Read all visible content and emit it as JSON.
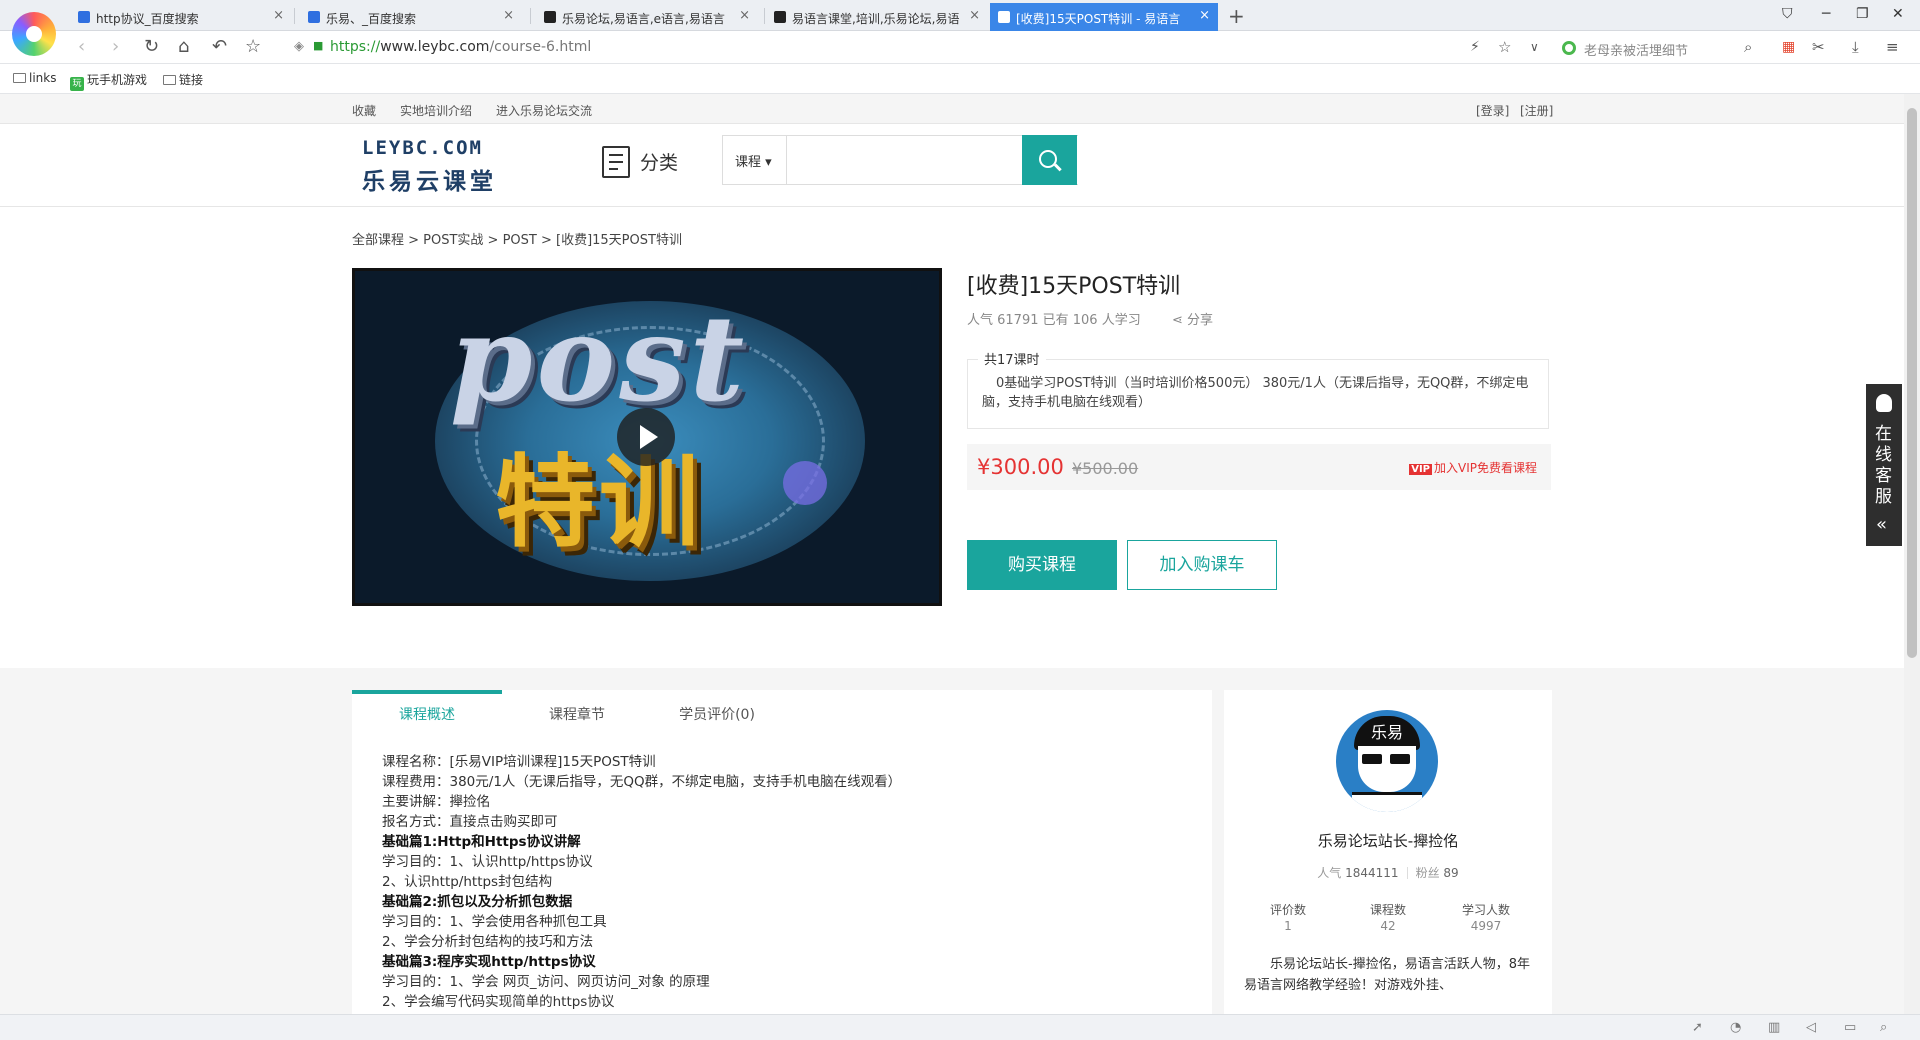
{
  "browser": {
    "tabs": [
      {
        "title": "http协议_百度搜索",
        "icon": "baidu-paw-icon",
        "active": false
      },
      {
        "title": "乐易、_百度搜索",
        "icon": "baidu-paw-icon",
        "active": false
      },
      {
        "title": "乐易论坛,易语言,e语言,易语言",
        "icon": "site-icon",
        "active": false
      },
      {
        "title": "易语言课堂,培训,乐易论坛,易语",
        "icon": "site-icon",
        "active": false
      },
      {
        "title": "[收费]15天POST特训 - 易语言",
        "icon": "site-icon",
        "active": true
      }
    ],
    "new_tab": "+",
    "url_scheme": "https://",
    "url_host": "www.leybc.com",
    "url_path": "/course-6.html",
    "search_hint": "老母亲被活埋细节",
    "bookmarks": [
      "links",
      "玩手机游戏",
      "链接"
    ],
    "accent": "#3a86e8"
  },
  "site": {
    "topbar": {
      "favorite": "收藏",
      "training": "实地培训介绍",
      "forum": "进入乐易论坛交流",
      "login": "[登录]",
      "register": "[注册]"
    },
    "logo_en": "LEYBC.COM",
    "logo_cn": "乐易云课堂",
    "category_label": "分类",
    "search_select": "课程",
    "search_placeholder": "",
    "accent": "#1aa59d"
  },
  "breadcrumb": "全部课程 > POST实战 > POST > [收费]15天POST特训",
  "video": {
    "title_text": "post",
    "subtitle_text": "特训"
  },
  "course": {
    "title": "[收费]15天POST特训",
    "meta": "人气 61791 已有 106 人学习",
    "share": "分享",
    "lessons_legend": "共17课时",
    "summary": "0基础学习POST特训（当时培训价格500元） 380元/1人（无课后指导，无QQ群，不绑定电脑，支持手机电脑在线观看）",
    "price_now": "¥300.00",
    "price_old": "¥500.00",
    "vip_badge": "VIP",
    "vip_text": "加入VIP免费看课程",
    "buy_label": "购买课程",
    "cart_label": "加入购课车"
  },
  "content_tabs": [
    "课程概述",
    "课程章节",
    "学员评价(0)"
  ],
  "description": [
    {
      "text": "课程名称：[乐易VIP培训课程]15天POST特训",
      "bold": false
    },
    {
      "text": "课程费用：380元/1人（无课后指导，无QQ群，不绑定电脑，支持手机电脑在线观看）",
      "bold": false
    },
    {
      "text": "主要讲解：攑捡佲",
      "bold": false
    },
    {
      "text": "报名方式：直接点击购买即可",
      "bold": false
    },
    {
      "text": "基础篇1:Http和Https协议讲解",
      "bold": true
    },
    {
      "text": "学习目的：1、认识http/https协议",
      "bold": false
    },
    {
      "text": "2、认识http/https封包结构",
      "bold": false
    },
    {
      "text": "基础篇2:抓包以及分析抓包数据",
      "bold": true
    },
    {
      "text": "学习目的：1、学会使用各种抓包工具",
      "bold": false
    },
    {
      "text": "2、学会分析封包结构的技巧和方法",
      "bold": false
    },
    {
      "text": "基础篇3:程序实现http/https协议",
      "bold": true
    },
    {
      "text": "学习目的：1、学会 网页_访问、网页访问_对象 的原理",
      "bold": false
    },
    {
      "text": "2、学会编写代码实现简单的https协议",
      "bold": false
    }
  ],
  "teacher": {
    "avatar_text": "乐易",
    "name": "乐易论坛站长-攑捡佲",
    "popularity_label": "人气",
    "popularity": "1844111",
    "fans_label": "粉丝",
    "fans": "89",
    "stats": [
      {
        "label": "评价数",
        "value": "1"
      },
      {
        "label": "课程数",
        "value": "42"
      },
      {
        "label": "学习人数",
        "value": "4997"
      }
    ],
    "bio": "乐易论坛站长-攑捡佲，易语言活跃人物，8年易语言网络教学经验！对游戏外挂、"
  },
  "float_service": {
    "text": "在线客服",
    "arrow": "«"
  }
}
